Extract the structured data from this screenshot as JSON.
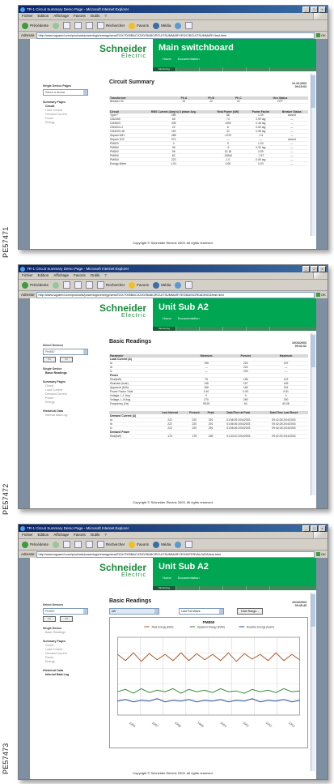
{
  "screenshots": [
    {
      "label": "PE57471",
      "window_title": "TR-1 Circuit Summary Demo Page - Microsoft Internet Explorer",
      "menu": [
        "Fichier",
        "Edition",
        "Affichage",
        "Favoris",
        "Outils",
        "?"
      ],
      "toolbar": {
        "back": "Précédente",
        "search": "Rechercher",
        "favorites": "Favoris",
        "media": "Média"
      },
      "address_label": "Adresse",
      "address": "http://www.sqyared.com/products/powerlogic/energy/sms/EGX/7000BACX200/3648CIRCUITSUMMARY/ES/CIRCUITSUMMARY/test.html",
      "go_label": "OK",
      "logo": {
        "line1": "Schneider",
        "line2": "Electric"
      },
      "page_title": "Main switchboard",
      "nav": [
        "Home",
        "Documentation"
      ],
      "active_tab": "Monitoring",
      "sidebar": {
        "select_header": "Single Device Pages",
        "select_value": "Select a device",
        "groups": [
          {
            "title": "Summary Pages",
            "items": [
              {
                "text": "Circuit",
                "bold": true
              },
              {
                "text": "Load Current",
                "bold": false
              },
              {
                "text": "Demand Current",
                "bold": false
              },
              {
                "text": "Power",
                "bold": false
              },
              {
                "text": "Energy",
                "bold": false
              }
            ]
          }
        ]
      },
      "content_title": "Circuit Summary",
      "date": "10.15.2003",
      "time": "09:15:03",
      "table1": {
        "headers": [
          "Transformer",
          "Ph A",
          "Ph B",
          "Ph C",
          "Gen Status"
        ],
        "rows": [
          [
            "Breaker 00",
            "22",
            "22",
            "22",
            "OFF"
          ]
        ]
      },
      "table2": {
        "headers": [
          "Circuit",
          "RMS Current (Amp's) 3 phase Avg.",
          "Real Power (kW)",
          "Power Factor",
          "Breaker Status"
        ],
        "rows": [
          [
            "Type F",
            "289",
            "86",
            "1.00",
            "closed"
          ],
          [
            "CM2450",
            "65",
            "74",
            "0.99 lag",
            "—"
          ],
          [
            "CM3603",
            "435",
            "1493",
            "0.46 lag",
            "—"
          ],
          [
            "CM4004-4",
            "22",
            "6",
            "0.63 lag",
            "—"
          ],
          [
            "CM4003-48",
            "118",
            "42",
            "0.98 lag",
            "—"
          ],
          [
            "Sepam M41",
            "488",
            "-4722",
            "-1.5",
            "—"
          ],
          [
            "Sepam S22",
            "974",
            "—",
            "—",
            "closed"
          ],
          [
            "PM620",
            "0",
            "0",
            "1.00",
            "—"
          ],
          [
            "PM650",
            "96",
            "-9",
            "0.32 lag",
            "—"
          ],
          [
            "PM800",
            "95",
            "13.18",
            "3.59",
            "—"
          ],
          [
            "PM500",
            "82",
            "-30540",
            "-7.87",
            "—"
          ],
          [
            "PM600",
            "222",
            "1.0",
            "0.09 lag",
            "—"
          ],
          [
            "Energy Meter",
            "1.51",
            "0.06",
            "0.03",
            "—"
          ]
        ]
      },
      "footer": "Copyright © Schneider Electric 2003. All rights reserved."
    },
    {
      "label": "PE57472",
      "window_title": "TR-1 Circuit Summary Demo Page - Microsoft Internet Explorer",
      "menu": [
        "Fichier",
        "Edition",
        "Affichage",
        "Favoris",
        "Outils",
        "?"
      ],
      "toolbar": {
        "back": "Précédente",
        "search": "Rechercher",
        "favorites": "Favoris",
        "media": "Média"
      },
      "address_label": "Adresse",
      "address": "http://www.sqyared.com/products/powerlogic/energy/sms/EGX/7000BACX200/3648CIRCUITSUMMARY/ES/BASICREADINGS/test.html",
      "go_label": "OK",
      "logo": {
        "line1": "Schneider",
        "line2": "Electric"
      },
      "page_title": "Unit Sub A2",
      "nav": [
        "Home",
        "Documentation"
      ],
      "active_tab": "Monitoring",
      "sidebar": {
        "select_header": "Select Devices",
        "select_value": "Pm850",
        "nav_prev": "<<",
        "nav_next": ">>",
        "groups": [
          {
            "title": "Single Device",
            "items": [
              {
                "text": "Basic Readings",
                "bold": true
              }
            ]
          },
          {
            "title": "Summary Pages",
            "items": [
              {
                "text": "Circuit",
                "bold": false
              },
              {
                "text": "Load Current",
                "bold": false
              },
              {
                "text": "Demand Current",
                "bold": false
              },
              {
                "text": "Power",
                "bold": false
              },
              {
                "text": "Energy",
                "bold": false
              }
            ]
          },
          {
            "title": "Historical Data",
            "items": [
              {
                "text": "Interval Data Log",
                "bold": false
              }
            ]
          }
        ]
      },
      "content_title": "Basic Readings",
      "date": "10/16/2003",
      "time": "09:41:02",
      "table1": {
        "headers": [
          "Parameter",
          "Minimum",
          "Present",
          "Maximum"
        ],
        "rows": [
          [
            "Load Current (A)",
            "",
            "",
            ""
          ],
          [
            "Ia",
            "196",
            "224",
            "237"
          ],
          [
            "Ib",
            "—",
            "224",
            "—"
          ],
          [
            "Ic",
            "—",
            "225",
            "—"
          ],
          [
            "Power",
            "",
            "",
            ""
          ],
          [
            "Real(kW)",
            "75",
            "156",
            "122"
          ],
          [
            "Reactive (kvar)",
            "136",
            "157",
            "169"
          ],
          [
            "Apparent (kVA)",
            "156",
            "166",
            "201"
          ],
          [
            "Power Factor Total",
            "0.40",
            "0.53",
            "0.81"
          ],
          [
            "Voltage, L-L Avg.",
            "0",
            "0",
            "0"
          ],
          [
            "Voltage, L-N Avg.",
            "270",
            "269",
            "290"
          ],
          [
            "Frequency (Hz)",
            "59.93",
            "60",
            "60.08"
          ]
        ]
      },
      "table2": {
        "headers": [
          "",
          "Last Interval",
          "Present",
          "Peak",
          "Date/Time at Peak",
          "Date/Time Last Reset"
        ],
        "rows": [
          [
            "Demand Current (A)",
            "",
            "",
            "",
            "",
            ""
          ],
          [
            "Ia",
            "222",
            "220",
            "291",
            "01:56:05  2/04/2003",
            "09:42:28  2/04/2003"
          ],
          [
            "Ib",
            "222",
            "220",
            "291",
            "01:56:06  2/04/2003",
            "09:42:28  2/04/2003"
          ],
          [
            "Ic",
            "222",
            "220",
            "291",
            "01:56:06  2/04/2003",
            "09:42:28  2/04/2003"
          ],
          [
            "Demand Power",
            "",
            "",
            "",
            "",
            ""
          ],
          [
            "Real(kW)",
            "176",
            "176",
            "189",
            "01:33:10  2/04/2003",
            "09:42:25  2/04/2003"
          ]
        ]
      },
      "footer": "Copyright © Schneider Electric 2003. All rights reserved."
    },
    {
      "label": "PE57473",
      "window_title": "TR-1 Circuit Summary Demo Page - Microsoft Internet Explorer",
      "menu": [
        "Fichier",
        "Edition",
        "Affichage",
        "Favoris",
        "Outils",
        "?"
      ],
      "toolbar": {
        "back": "Précédente",
        "search": "Rechercher",
        "favorites": "Favoris",
        "media": "Média"
      },
      "address_label": "Adresse",
      "address": "http://www.sqyared.com/products/powerlogic/energy/sms/EGX/7000BACX200/3648CIRCUITSUMMARY/ES/INTERVALDATA/test.html",
      "go_label": "OK",
      "logo": {
        "line1": "Schneider",
        "line2": "Electric"
      },
      "page_title": "Unit Sub A2",
      "nav": [
        "Home",
        "Documentation"
      ],
      "active_tab": "Monitoring",
      "sidebar": {
        "select_header": "Select Devices",
        "select_value": "Pm850",
        "nav_prev": "<<",
        "nav_next": ">>",
        "groups": [
          {
            "title": "Single Device",
            "items": [
              {
                "text": "Basic Readings",
                "bold": false
              }
            ]
          },
          {
            "title": "Summary Pages",
            "items": [
              {
                "text": "Circuit",
                "bold": false
              },
              {
                "text": "Load Current",
                "bold": false
              },
              {
                "text": "Demand Current",
                "bold": false
              },
              {
                "text": "Power",
                "bold": false
              },
              {
                "text": "Energy",
                "bold": false
              }
            ]
          },
          {
            "title": "Historical Data",
            "items": [
              {
                "text": "Interval Data Log",
                "bold": true
              }
            ]
          }
        ]
      },
      "content_title": "Basic Readings",
      "date": "10/16/2003",
      "time": "09:45:45",
      "chart_controls": {
        "channel": "kW",
        "period": "Last Full Week",
        "button": "Date Range..."
      },
      "chart_title": "PM850",
      "legend": [
        "Real Energy (kWh)",
        "Apparent Energy (kVAh)",
        "Reactive Energy (kvarh)"
      ],
      "footer": "Copyright © Schneider Electric 2003. All rights reserved.",
      "chart_data": {
        "type": "line",
        "title": "PM850",
        "x": [
          "10/06",
          "10/07",
          "10/08",
          "10/09",
          "10/10",
          "10/11",
          "10/12",
          "10/13"
        ],
        "series": [
          {
            "name": "Real Energy (kWh)",
            "color": "#b05a2a",
            "values": [
              78,
              70,
              80,
              69,
              79,
              71,
              78,
              70,
              80,
              70,
              79,
              71,
              78,
              70,
              80,
              69,
              79,
              72,
              78,
              70,
              80,
              70,
              78,
              71
            ]
          },
          {
            "name": "Apparent Energy (kVAh)",
            "color": "#3a8a3a",
            "values": [
              30,
              33,
              28,
              34,
              29,
              32,
              30,
              34,
              28,
              33,
              30,
              32,
              29,
              34,
              30,
              31,
              28,
              33,
              30,
              32,
              29,
              34,
              30,
              31
            ]
          },
          {
            "name": "Reactive Energy (kvarh)",
            "color": "#2a4a9a",
            "values": [
              18,
              20,
              17,
              19,
              18,
              21,
              17,
              19,
              18,
              20,
              17,
              19,
              18,
              20,
              17,
              19,
              18,
              21,
              17,
              19,
              18,
              20,
              17,
              19
            ]
          }
        ],
        "ylim": [
          0,
          100
        ],
        "grid": true,
        "legend_position": "top"
      }
    }
  ]
}
